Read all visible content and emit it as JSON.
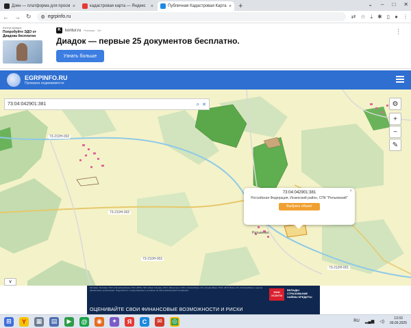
{
  "browser": {
    "tabs": [
      {
        "title": "Дзен — платформа для просм",
        "color": "#222222"
      },
      {
        "title": "кадастровая карта — Яндекс",
        "color": "#e53935"
      },
      {
        "title": "Публичная Кадастровая Карта",
        "color": "#1e88e5"
      }
    ],
    "new_tab": "+",
    "url": "egrpinfo.ru"
  },
  "ad_top": {
    "brand": "Контур Диадок",
    "left_text": "Попробуйте ЭДО от Диадока бесплатно",
    "source": "kontur.ru",
    "source_note": "Реклама · 16+",
    "title": "Диадок — первые 25 документов бесплатно.",
    "button": "Узнать больше"
  },
  "site": {
    "name": "EGRPINFO.RU",
    "subtitle": "Проверка недвижимости"
  },
  "map": {
    "search_value": "73:04:042901:381",
    "zoom_in": "+",
    "zoom_out": "−",
    "road_labels": [
      "73-210Н-002",
      "73-210Н-002",
      "73-210Н-002",
      "73-210Н-001"
    ],
    "town_label": "Ритьвеево",
    "popup": {
      "cadastral_id": "73:04:042901:381",
      "address": "Российская Федерация, Инзенский район, СПК \"Рельевский\"",
      "button": "Выбрать объект",
      "close": "×"
    },
    "collapse": "∨"
  },
  "ad_bottom": {
    "fine_print": "Реклама. Реклама: ПАО «Промсвязьбанк» ПАО «ВТБ» ПАО «Банк Синара» ООО «Финуслуги» ПАО «Совкомбанк» АО «Альфа-Банк» ПАО «МТС-Банк» АО «Газпромбанк» и другие финансовые организации. Подробности о предложениях и условиях на сайте финансовой платформы.",
    "badge": "ФИН УСЛУГИ",
    "side_text": "ВКЛАДЫ СТРАХОВАНИЕ ЗАЙМЫ КРЕДИТЫ",
    "main_line": "ОЦЕНИВАЙТЕ СВОИ ФИНАНСОВЫЕ ВОЗМОЖНОСТИ И РИСКИ"
  },
  "taskbar": {
    "lang": "RU",
    "time": "13:33",
    "date": "09.06.2025"
  }
}
